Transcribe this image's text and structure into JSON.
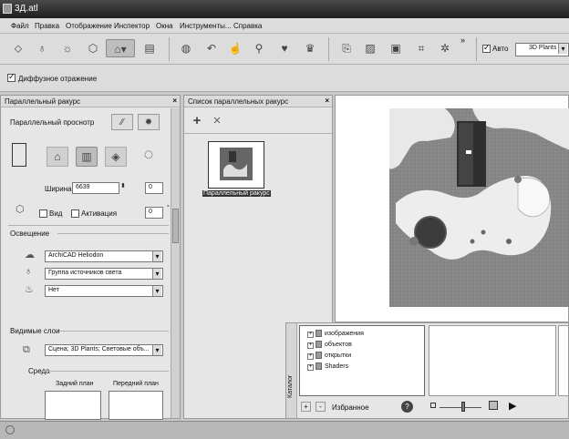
{
  "window": {
    "title": "3Д.atl"
  },
  "menu": [
    "Файл",
    "Правка",
    "Отображение",
    "Инспектор",
    "Окна",
    "Инструменты...",
    "Справка"
  ],
  "toolbar": {
    "auto_label": "Авто",
    "plants_value": "3D Plants",
    "overflow": "»",
    "icons": [
      "select-icon",
      "light-icon",
      "sun-icon",
      "object-icon",
      "camera-icon",
      "view-icon",
      "navigate-icon",
      "undo-icon",
      "hand-icon",
      "zoom-icon",
      "torch-icon",
      "paint-icon",
      "frame-icon",
      "image-icon",
      "render-icon",
      "crop-icon",
      "settings-icon"
    ]
  },
  "options": {
    "diffuse_label": "Диффузное отражение"
  },
  "left_panel": {
    "title": "Параллельный ракурс",
    "close": "×",
    "view_label": "Параллельный проснотр",
    "width_label": "Ширина:",
    "width_value": "6639",
    "width_right_value": "0",
    "view_check_label": "Вид",
    "activate_check_label": "Активация",
    "activate_value": "0",
    "lighting_label": "Освещение",
    "light_options": [
      "ArchiCAD Heliodon",
      "Группа источников света",
      "Нет"
    ],
    "layers_label": "Видимые слои",
    "layers_value": "Сцена; 3D Plants; Световые объ...",
    "env_label": "Среда",
    "background_label": "Задний план",
    "foreground_label": "Передний план"
  },
  "mid_panel": {
    "title": "Список параллельных ракурс",
    "close": "×",
    "add": "+",
    "remove": "×",
    "item_label": "Параллельный ракурс"
  },
  "catalog": {
    "side_label": "Каталог",
    "tree": [
      "изображения",
      "объектов",
      "открытки",
      "Shaders"
    ],
    "favorites_label": "Избранное",
    "buttons": [
      "+",
      "-"
    ],
    "help": "?",
    "play": "▶"
  }
}
